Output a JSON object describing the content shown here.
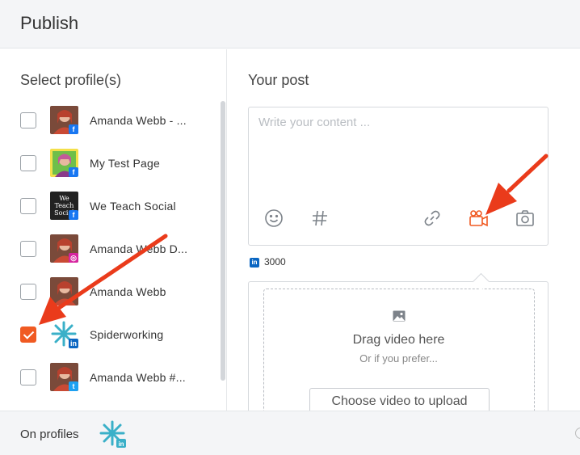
{
  "header": {
    "title": "Publish"
  },
  "profiles_section": {
    "title": "Select profile(s)",
    "items": [
      {
        "name": "Amanda Webb - ...",
        "checked": false,
        "network": "facebook",
        "avatar": "person"
      },
      {
        "name": "My Test Page",
        "checked": false,
        "network": "facebook",
        "avatar": "person-green"
      },
      {
        "name": "We Teach Social",
        "checked": false,
        "network": "facebook",
        "avatar": "text-logo",
        "avatar_text": "We Teach Social"
      },
      {
        "name": "Amanda Webb D...",
        "checked": false,
        "network": "instagram",
        "avatar": "person"
      },
      {
        "name": "Amanda Webb",
        "checked": false,
        "network": "none",
        "avatar": "person"
      },
      {
        "name": "Spiderworking",
        "checked": true,
        "network": "linkedin",
        "avatar": "spider-logo"
      },
      {
        "name": "Amanda Webb  #...",
        "checked": false,
        "network": "twitter",
        "avatar": "person"
      }
    ]
  },
  "post_section": {
    "title": "Your post",
    "placeholder": "Write your content ...",
    "character_limit": "3000",
    "tools": [
      "emoji-icon",
      "hashtag-icon",
      "link-icon",
      "video-icon",
      "photo-icon"
    ],
    "active_tool": "video-icon"
  },
  "media": {
    "drag_text": "Drag video here",
    "sub_text": "Or if you prefer...",
    "button_label": "Choose video to upload"
  },
  "footer": {
    "label": "On profiles"
  },
  "colors": {
    "accent": "#f05a22",
    "arrow": "#ea3b1b",
    "linkedin": "#0a66c2",
    "facebook": "#1877f2",
    "twitter": "#1da1f2",
    "instagram": "#d6249f"
  }
}
